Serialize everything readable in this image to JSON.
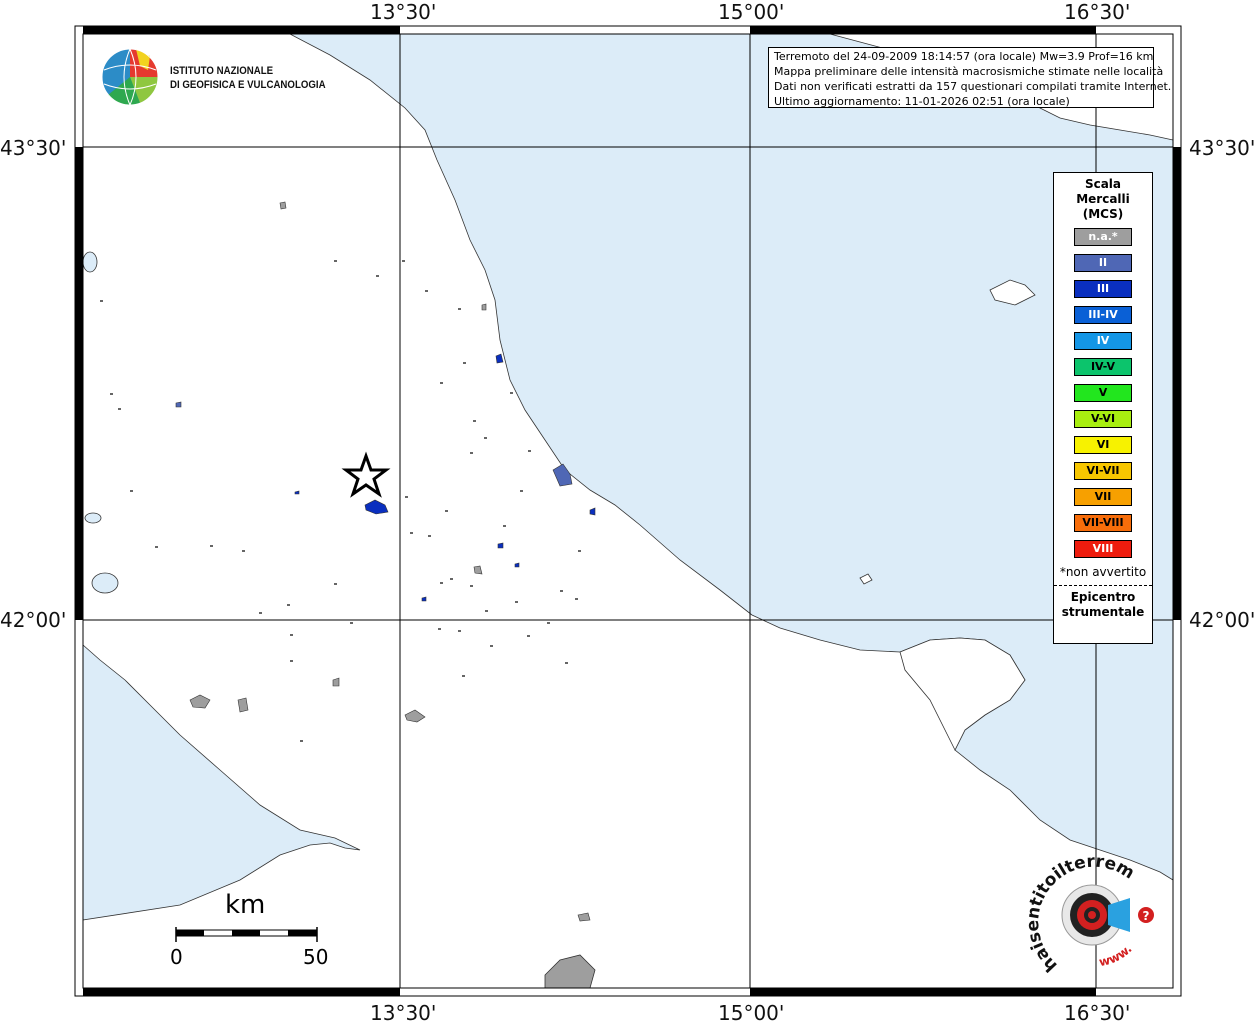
{
  "map": {
    "lon_labels": [
      "13°30'",
      "15°00'",
      "16°30'"
    ],
    "lat_labels": [
      "43°30'",
      "42°00'"
    ]
  },
  "info": {
    "line1": "Terremoto del 24-09-2009 18:14:57 (ora locale) Mw=3.9 Prof=16 km",
    "line2": "Mappa preliminare delle intensità macrosismiche stimate nelle località",
    "line3": "Dati non verificati estratti da 157 questionari compilati tramite Internet.",
    "line4": "Ultimo aggiornamento: 11-01-2026 02:51 (ora locale)"
  },
  "ingv": {
    "line1": "ISTITUTO NAZIONALE",
    "line2": "DI GEOFISICA E VULCANOLOGIA"
  },
  "legend": {
    "title1": "Scala",
    "title2": "Mercalli",
    "title3": "(MCS)",
    "items": [
      {
        "label": "n.a.*",
        "color": "#9e9e9e"
      },
      {
        "label": "II",
        "color": "#4f67b5"
      },
      {
        "label": "III",
        "color": "#0a2fbf"
      },
      {
        "label": "III-IV",
        "color": "#0a60d6"
      },
      {
        "label": "IV",
        "color": "#1496e6"
      },
      {
        "label": "IV-V",
        "color": "#0cc46c"
      },
      {
        "label": "V",
        "color": "#22e61e"
      },
      {
        "label": "V-VI",
        "color": "#a8ee10"
      },
      {
        "label": "VI",
        "color": "#f7f200"
      },
      {
        "label": "VI-VII",
        "color": "#f7c600"
      },
      {
        "label": "VII",
        "color": "#f7a000"
      },
      {
        "label": "VII-VIII",
        "color": "#f76d0a"
      },
      {
        "label": "VIII",
        "color": "#ee1c0e"
      }
    ],
    "note": "*non avvertito",
    "epi1": "Epicentro",
    "epi2": "strumentale"
  },
  "scale": {
    "title": "km",
    "zero": "0",
    "fifty": "50"
  },
  "brand": {
    "text": "haisentitoilterremoto.it",
    "www": "www.",
    "question": "?"
  },
  "colors": {
    "sea": "#dcecf8",
    "land": "#ffffff",
    "frame": "#000000",
    "grey_town": "#9e9e9e",
    "blue_town": "#4f67b5",
    "dblue_town": "#0a2fbf"
  }
}
